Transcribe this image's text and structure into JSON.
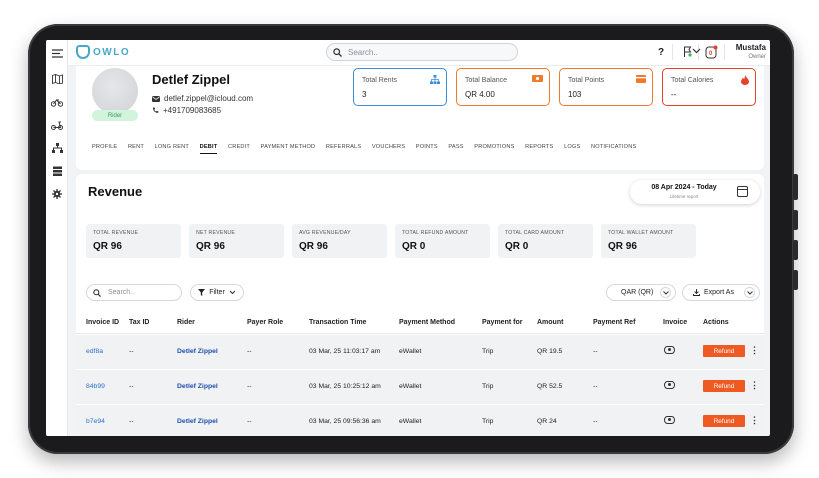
{
  "app": {
    "logo_text": "OWLO"
  },
  "topbar": {
    "search_placeholder": "Search..",
    "help_label": "?",
    "user_name": "Mustafa",
    "user_role": "Owner"
  },
  "rail": {
    "items": [
      "menu-icon",
      "map-icon",
      "bike-icon",
      "scooter-icon",
      "network-icon",
      "layers-icon",
      "gear-icon"
    ]
  },
  "profile": {
    "name": "Detlef Zippel",
    "email": "detlef.zippel@icloud.com",
    "phone": "+491709083685",
    "badge": "Rider"
  },
  "stats": [
    {
      "label": "Total Rents",
      "value": "3",
      "icon": "sitemap-icon",
      "color": "#3a8fd9"
    },
    {
      "label": "Total Balance",
      "value": "QR 4.00",
      "icon": "cash-icon",
      "color": "#f07a2a"
    },
    {
      "label": "Total Points",
      "value": "103",
      "icon": "card-icon",
      "color": "#f07a2a"
    },
    {
      "label": "Total Calories",
      "value": "--",
      "icon": "flame-icon",
      "color": "#e4432a"
    }
  ],
  "tabs": [
    "PROFILE",
    "RENT",
    "LONG RENT",
    "DEBIT",
    "CREDIT",
    "PAYMENT METHOD",
    "REFERRALS",
    "VOUCHERS",
    "POINTS",
    "PASS",
    "PROMOTIONS",
    "REPORTS",
    "LOGS",
    "NOTIFICATIONS"
  ],
  "active_tab": "DEBIT",
  "revenue": {
    "title": "Revenue",
    "date_range": "08 Apr 2024 - Today",
    "date_sub": "Lifetime report",
    "metrics": [
      {
        "label": "TOTAL REVENUE",
        "value": "QR 96"
      },
      {
        "label": "NET REVENUE",
        "value": "QR 96"
      },
      {
        "label": "AVG REVENUE/DAY",
        "value": "QR 96"
      },
      {
        "label": "TOTAL REFUND AMOUNT",
        "value": "QR 0"
      },
      {
        "label": "TOTAL CARD AMOUNT",
        "value": "QR 0"
      },
      {
        "label": "TOTAL WALLET AMOUNT",
        "value": "QR 96"
      }
    ],
    "search_placeholder": "Search..",
    "filter_label": "Filter",
    "currency_label": "QAR (QR)",
    "export_label": "Export As"
  },
  "table": {
    "columns": [
      "Invoice ID",
      "Tax ID",
      "Rider",
      "Payer Role",
      "Transaction Time",
      "Payment Method",
      "Payment for",
      "Amount",
      "Payment Ref",
      "Invoice",
      "Actions"
    ],
    "rows": [
      {
        "invoice_id": "edf8a",
        "tax_id": "--",
        "rider": "Detlef Zippel",
        "payer_role": "--",
        "time": "03 Mar, 25 11:03:17 am",
        "method": "eWallet",
        "payment_for": "Trip",
        "amount": "QR 19.5",
        "ref": "--",
        "action": "Refund"
      },
      {
        "invoice_id": "84b99",
        "tax_id": "--",
        "rider": "Detlef Zippel",
        "payer_role": "--",
        "time": "03 Mar, 25 10:25:12 am",
        "method": "eWallet",
        "payment_for": "Trip",
        "amount": "QR 52.5",
        "ref": "--",
        "action": "Refund"
      },
      {
        "invoice_id": "b7e94",
        "tax_id": "--",
        "rider": "Detlef Zippel",
        "payer_role": "--",
        "time": "03 Mar, 25 09:56:36 am",
        "method": "eWallet",
        "payment_for": "Trip",
        "amount": "QR 24",
        "ref": "--",
        "action": "Refund"
      }
    ]
  }
}
